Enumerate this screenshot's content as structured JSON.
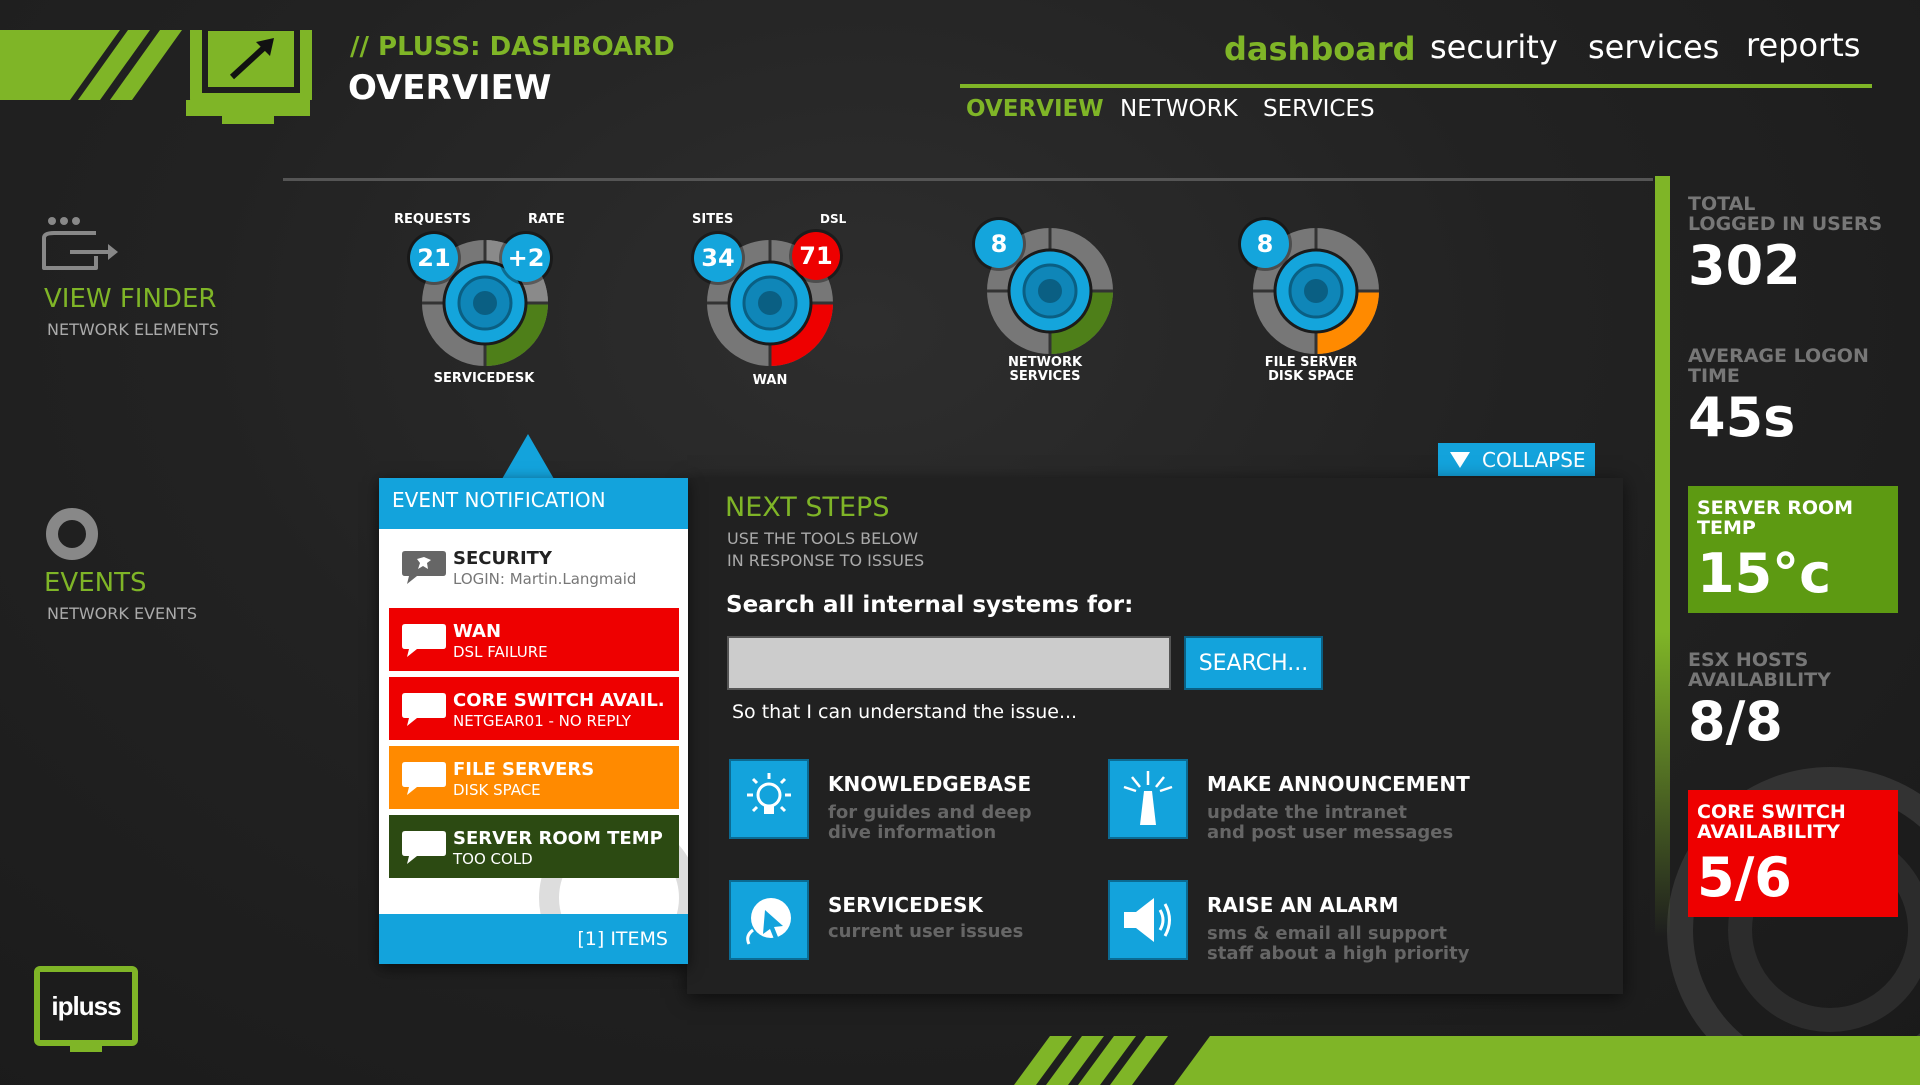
{
  "header": {
    "subtitle": "// PLUSS: DASHBOARD",
    "title": "OVERVIEW",
    "nav": [
      "dashboard",
      "security",
      "services",
      "reports"
    ],
    "subnav": [
      "OVERVIEW",
      "NETWORK",
      "SERVICES"
    ]
  },
  "sidebar": {
    "view_finder": {
      "title": "VIEW FINDER",
      "sub": "NETWORK ELEMENTS"
    },
    "events": {
      "title": "EVENTS",
      "sub": "NETWORK EVENTS"
    }
  },
  "gauges": {
    "servicedesk": {
      "label": "SERVICEDESK",
      "left_label": "REQUESTS",
      "left_value": "21",
      "right_label": "RATE",
      "right_value": "+2"
    },
    "wan": {
      "label": "WAN",
      "left_label": "SITES",
      "left_value": "34",
      "right_label": "DSL",
      "right_value": "71"
    },
    "network_services": {
      "label1": "NETWORK",
      "label2": "SERVICES",
      "value": "8"
    },
    "file_server": {
      "label1": "FILE SERVER",
      "label2": "DISK SPACE",
      "value": "8"
    }
  },
  "collapse_label": "COLLAPSE",
  "event_panel": {
    "title": "EVENT NOTIFICATION",
    "items": [
      {
        "title": "SECURITY",
        "sub": "LOGIN: Martin.Langmaid",
        "color": "#ffffff"
      },
      {
        "title": "WAN",
        "sub": "DSL FAILURE",
        "color": "#ee0000"
      },
      {
        "title": "CORE SWITCH AVAIL.",
        "sub": "NETGEAR01 - NO REPLY",
        "color": "#ee0000"
      },
      {
        "title": "FILE SERVERS",
        "sub": "DISK SPACE",
        "color": "#ff8a00"
      },
      {
        "title": "SERVER ROOM TEMP",
        "sub": "TOO COLD",
        "color": "#2c4a12"
      }
    ],
    "footer": "[1] ITEMS"
  },
  "next_steps": {
    "title": "NEXT STEPS",
    "sub1": "USE THE TOOLS BELOW",
    "sub2": "IN RESPONSE TO ISSUES",
    "search_label": "Search all internal systems for:",
    "search_value": "",
    "search_button": "SEARCH...",
    "hint": "So that I can understand the issue...",
    "tools": [
      {
        "title": "KNOWLEDGEBASE",
        "desc1": "for guides and deep",
        "desc2": "dive information",
        "icon": "lightbulb-icon"
      },
      {
        "title": "MAKE ANNOUNCEMENT",
        "desc1": "update the intranet",
        "desc2": "and post user messages",
        "icon": "beacon-icon"
      },
      {
        "title": "SERVICEDESK",
        "desc1": "current user issues",
        "desc2": "",
        "icon": "cursor-click-icon"
      },
      {
        "title": "RAISE AN ALARM",
        "desc1": "sms & email all support",
        "desc2": "staff about a high priority",
        "icon": "speaker-icon"
      }
    ]
  },
  "stats": {
    "users": {
      "label1": "TOTAL",
      "label2": "LOGGED IN USERS",
      "value": "302"
    },
    "logon": {
      "label1": "AVERAGE LOGON",
      "label2": "TIME",
      "value": "45s"
    },
    "temp": {
      "label1": "SERVER ROOM",
      "label2": "TEMP",
      "value": "15°c"
    },
    "esx": {
      "label1": "ESX HOSTS",
      "label2": "AVAILABILITY",
      "value": "8/8"
    },
    "core": {
      "label1": "CORE SWITCH",
      "label2": "AVAILABILITY",
      "value": "5/6"
    }
  },
  "logo": {
    "text": "ipluss"
  },
  "colors": {
    "accent_green": "#7fb527",
    "accent_blue": "#13a3dc",
    "alert_red": "#ee0000",
    "warn_orange": "#ff8a00"
  }
}
